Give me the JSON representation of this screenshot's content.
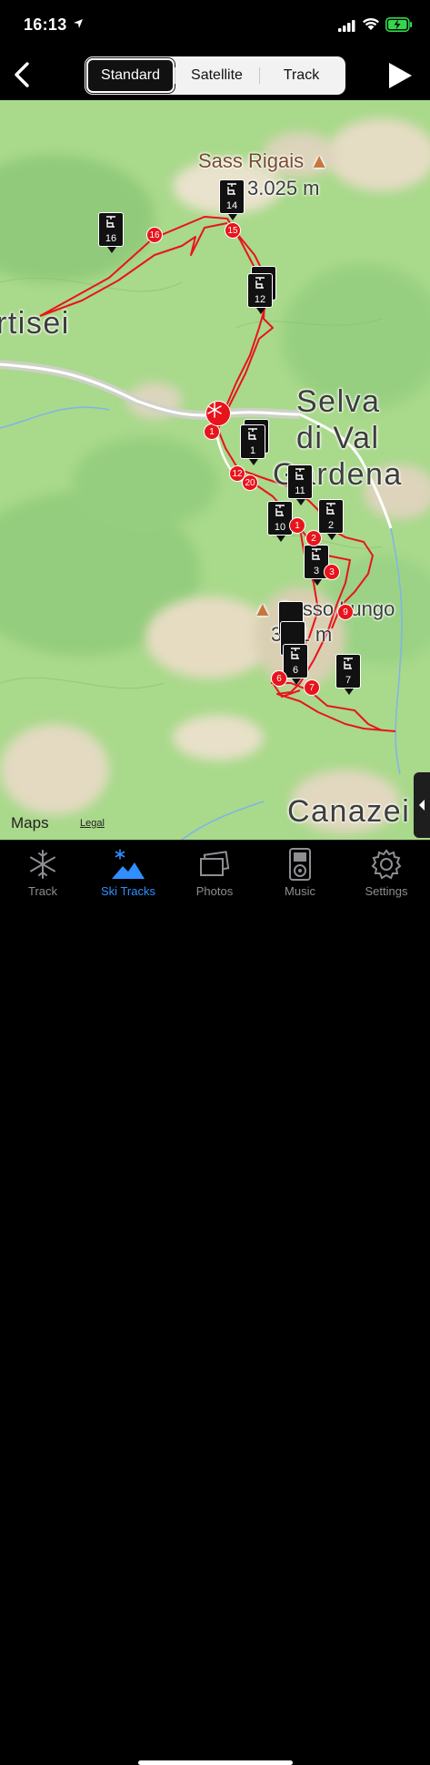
{
  "status": {
    "time": "16:13"
  },
  "nav": {
    "segments": [
      "Standard",
      "Satellite",
      "Track"
    ],
    "selected": "Standard"
  },
  "map": {
    "peaks": [
      {
        "name": "Sass Rigais",
        "elevation": "3.025 m"
      },
      {
        "name": "Sasso Lungo",
        "elevation": "3.181 m",
        "elevation_visible": "3 31 m"
      }
    ],
    "towns": [
      "rtisei",
      "Selva",
      "di Val",
      "Gardena",
      "Canazei"
    ],
    "lifts": [
      "16",
      "14",
      "12",
      "1",
      "11",
      "10",
      "2",
      "3",
      "6",
      "7"
    ],
    "points": [
      "16",
      "15",
      "1",
      "12",
      "20",
      "2",
      "1",
      "3",
      "9",
      "6",
      "7"
    ],
    "attribution": "Maps",
    "legal": "Legal",
    "route_color": "#e8141c"
  },
  "tabs": [
    {
      "label": "Track",
      "icon": "snowflake-icon"
    },
    {
      "label": "Ski Tracks",
      "icon": "ski-mountain-icon",
      "active": true
    },
    {
      "label": "Photos",
      "icon": "photos-icon"
    },
    {
      "label": "Music",
      "icon": "ipod-icon"
    },
    {
      "label": "Settings",
      "icon": "gear-icon"
    }
  ],
  "colors": {
    "accent": "#2f8fff",
    "route": "#e8141c",
    "map_green": "#a8d88a"
  }
}
